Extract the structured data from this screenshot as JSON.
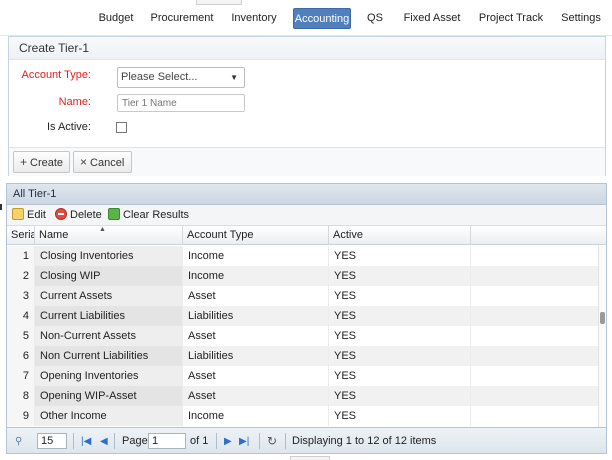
{
  "nav": {
    "items": [
      {
        "label": "Budget",
        "active": false
      },
      {
        "label": "Procurement",
        "active": false
      },
      {
        "label": "Inventory",
        "active": false
      },
      {
        "label": "Accounting",
        "active": true
      },
      {
        "label": "QS",
        "active": false
      },
      {
        "label": "Fixed Asset",
        "active": false
      },
      {
        "label": "Project Track",
        "active": false
      },
      {
        "label": "Settings",
        "active": false
      }
    ]
  },
  "create_form": {
    "title": "Create Tier-1",
    "account_type_label": "Account Type:",
    "account_type_value": "Please Select...",
    "name_label": "Name:",
    "name_placeholder": "Tier 1 Name",
    "is_active_label": "Is Active:",
    "is_active_checked": false,
    "create_button": "Create",
    "cancel_button": "Cancel"
  },
  "grid": {
    "title": "All Tier-1",
    "toolbar": {
      "edit": "Edit",
      "delete": "Delete",
      "clear": "Clear Results"
    },
    "columns": [
      "Serial",
      "Name",
      "Account Type",
      "Active"
    ],
    "rows": [
      {
        "serial": "1",
        "name": "Closing Inventories",
        "type": "Income",
        "active": "YES"
      },
      {
        "serial": "2",
        "name": "Closing WIP",
        "type": "Income",
        "active": "YES"
      },
      {
        "serial": "3",
        "name": "Current Assets",
        "type": "Asset",
        "active": "YES"
      },
      {
        "serial": "4",
        "name": "Current Liabilities",
        "type": "Liabilities",
        "active": "YES"
      },
      {
        "serial": "5",
        "name": "Non-Current Assets",
        "type": "Asset",
        "active": "YES"
      },
      {
        "serial": "6",
        "name": "Non Current Liabilities",
        "type": "Liabilities",
        "active": "YES"
      },
      {
        "serial": "7",
        "name": "Opening Inventories",
        "type": "Asset",
        "active": "YES"
      },
      {
        "serial": "8",
        "name": "Opening WIP-Asset",
        "type": "Asset",
        "active": "YES"
      },
      {
        "serial": "9",
        "name": "Other Income",
        "type": "Income",
        "active": "YES"
      }
    ],
    "pager": {
      "page_size": "15",
      "page_label": "Page",
      "page_value": "1",
      "of_label": "of 1",
      "display_text": "Displaying 1 to 12 of 12 items"
    }
  },
  "colors": {
    "accent": "#4f7fbd",
    "required": "#e02020"
  }
}
